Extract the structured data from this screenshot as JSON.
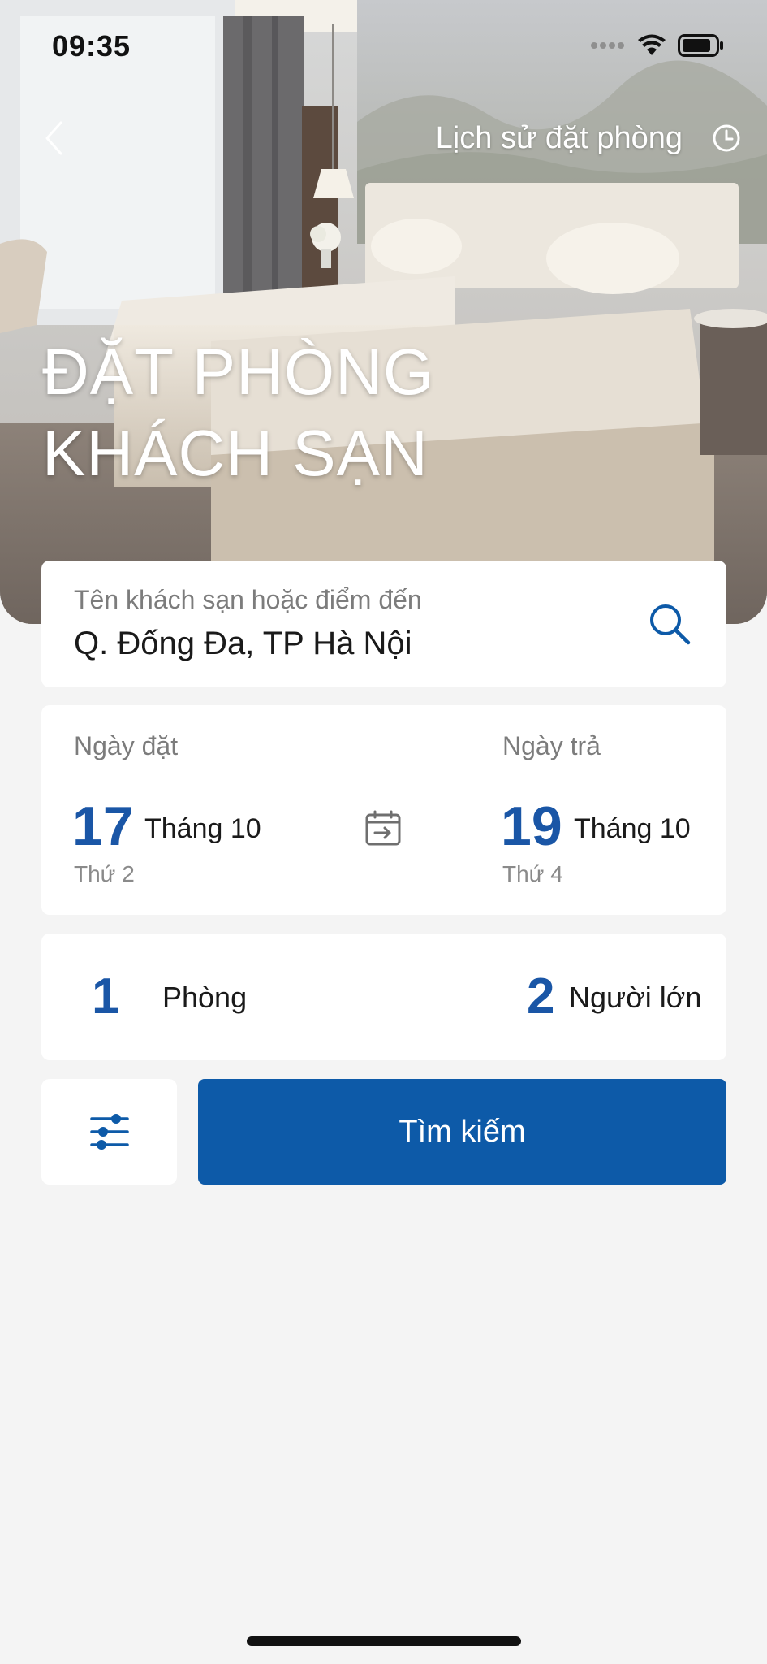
{
  "status_bar": {
    "time": "09:35"
  },
  "nav": {
    "back_icon": "chevron-left-icon",
    "history_label": "Lịch sử đặt phòng",
    "history_icon": "clock-icon"
  },
  "hero": {
    "title_line1": "ĐẶT PHÒNG",
    "title_line2": "KHÁCH SẠN"
  },
  "search": {
    "label": "Tên khách sạn hoặc điểm đến",
    "value": "Q. Đống Đa, TP Hà Nội",
    "icon": "search-icon"
  },
  "dates": {
    "checkin": {
      "label": "Ngày đặt",
      "day": "17",
      "month": "Tháng 10",
      "weekday": "Thứ 2"
    },
    "checkout": {
      "label": "Ngày trả",
      "day": "19",
      "month": "Tháng 10",
      "weekday": "Thứ 4"
    },
    "icon": "calendar-arrow-icon"
  },
  "guests": {
    "rooms_count": "1",
    "rooms_label": "Phòng",
    "adults_count": "2",
    "adults_label": "Người lớn"
  },
  "actions": {
    "filter_icon": "sliders-icon",
    "search_button": "Tìm kiếm"
  },
  "colors": {
    "accent": "#0d5aa8",
    "number_blue": "#1a56a6",
    "background": "#f4f4f4"
  }
}
